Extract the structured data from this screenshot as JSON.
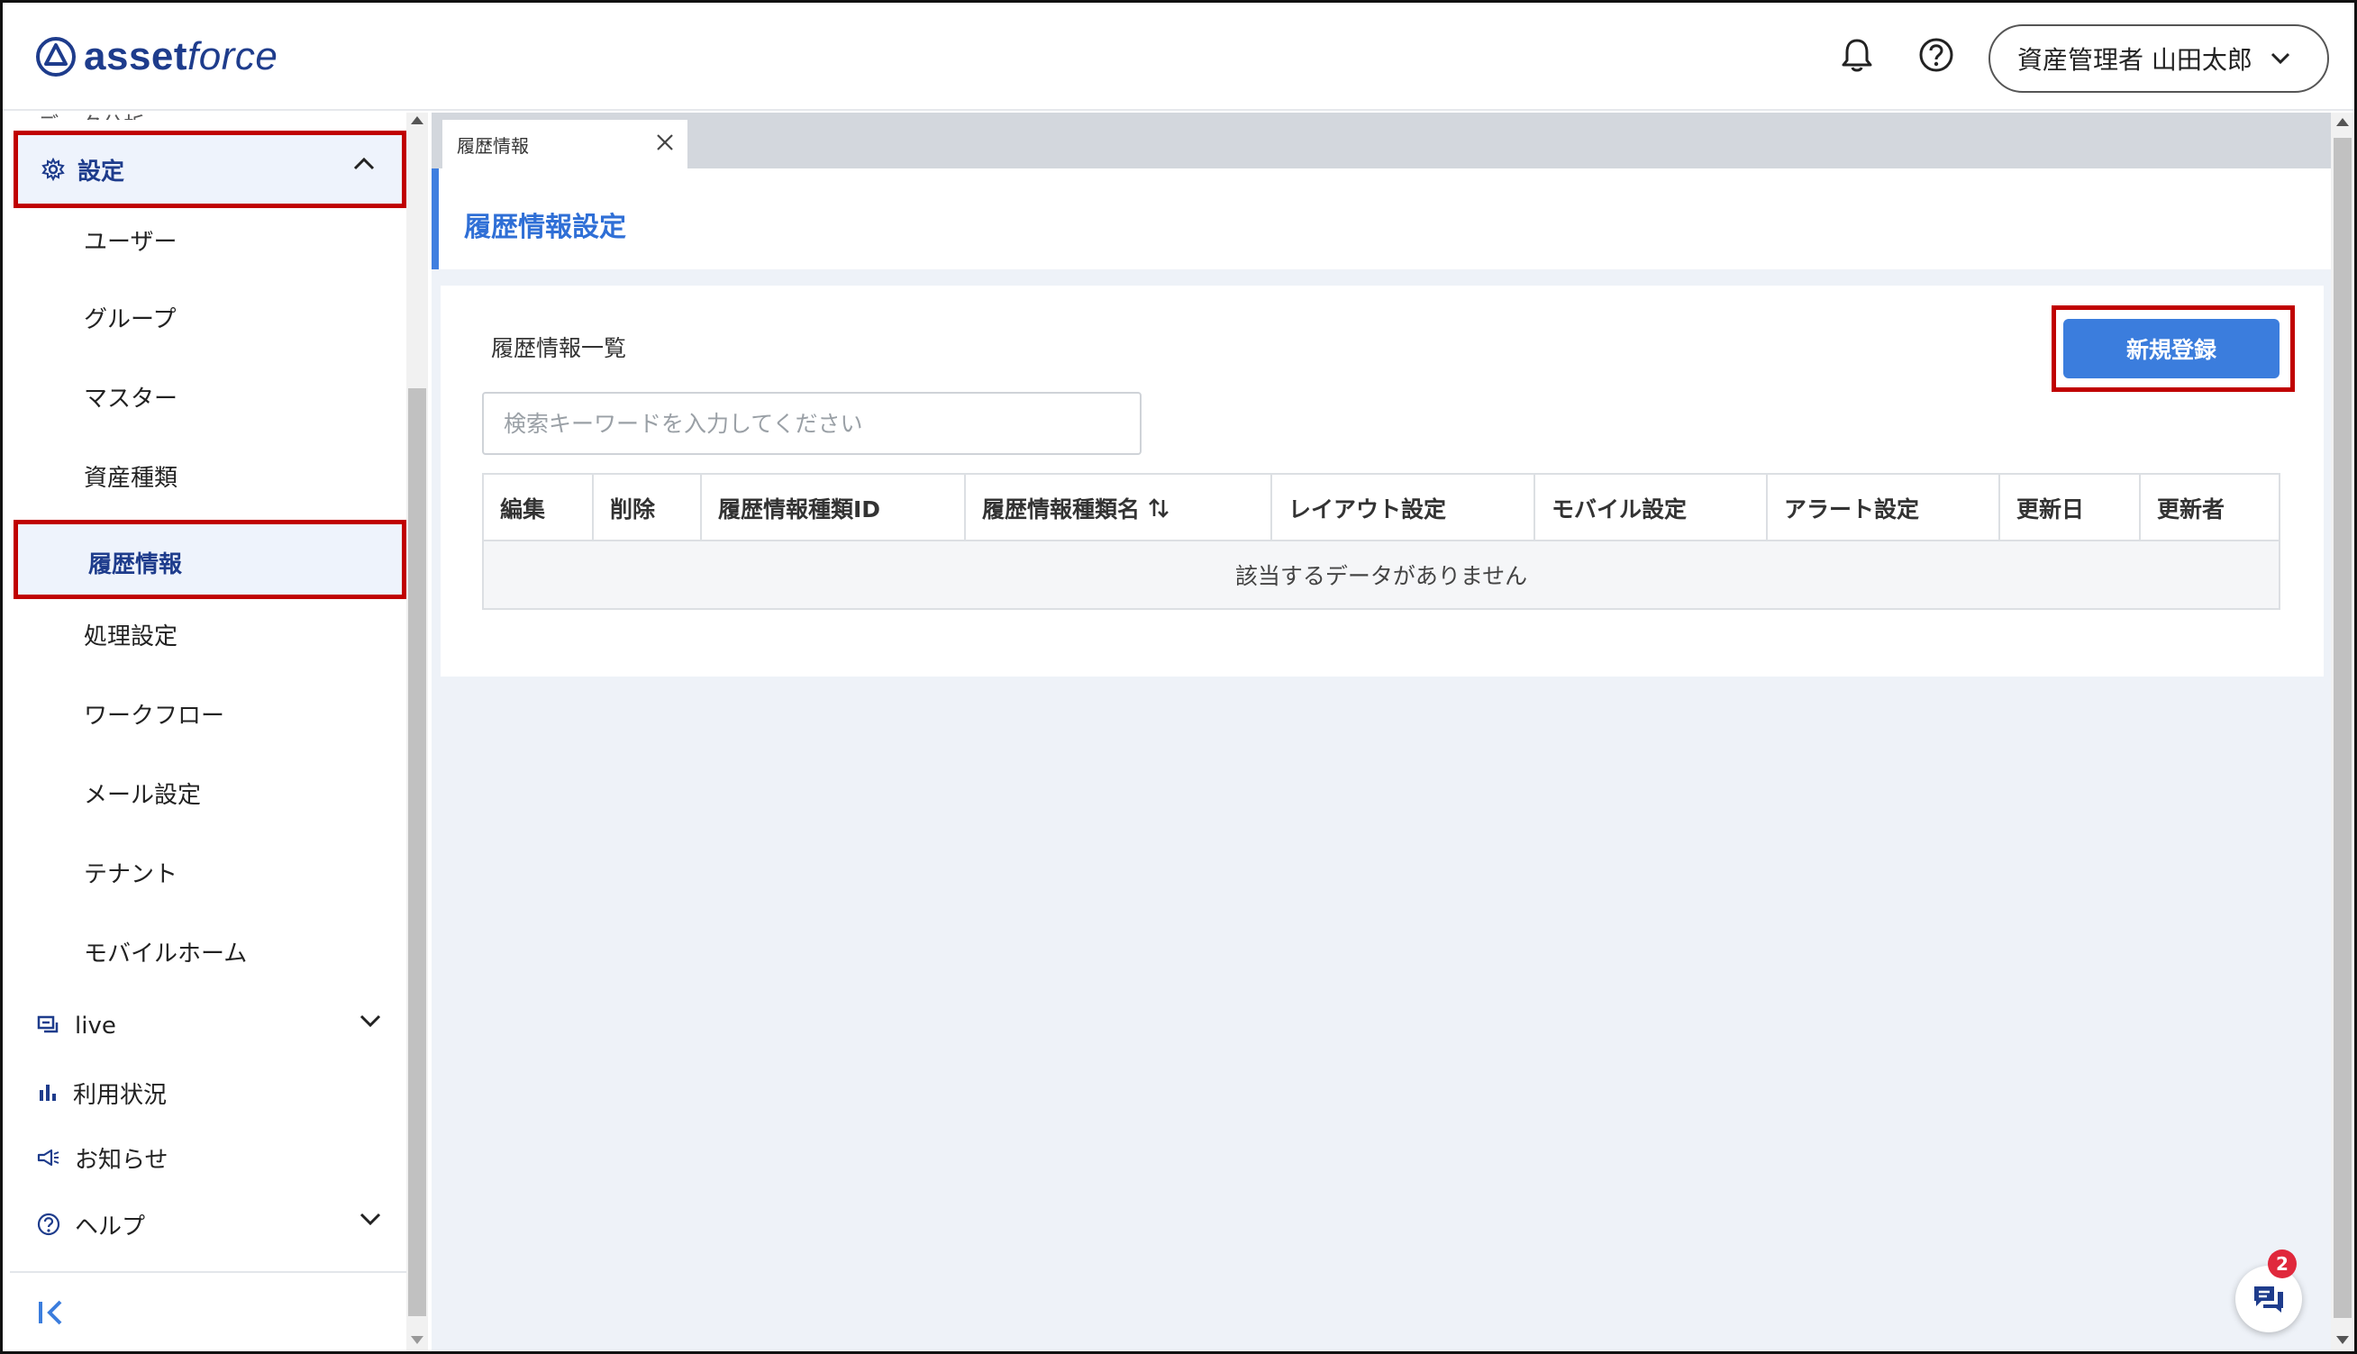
{
  "header": {
    "logo_bold": "asset",
    "logo_italic": "force",
    "user_label": "資産管理者 山田太郎"
  },
  "sidebar": {
    "cut_item": "データ分析",
    "settings_label": "設定",
    "sub_items": [
      {
        "label": "ユーザー"
      },
      {
        "label": "グループ"
      },
      {
        "label": "マスター"
      },
      {
        "label": "資産種類"
      },
      {
        "label": "履歴情報"
      },
      {
        "label": "処理設定"
      },
      {
        "label": "ワークフロー"
      },
      {
        "label": "メール設定"
      },
      {
        "label": "テナント"
      },
      {
        "label": "モバイルホーム"
      }
    ],
    "main_items": [
      {
        "label": "live"
      },
      {
        "label": "利用状況"
      },
      {
        "label": "お知らせ"
      },
      {
        "label": "ヘルプ"
      }
    ]
  },
  "tabs": [
    {
      "label": "履歴情報"
    }
  ],
  "page": {
    "title": "履歴情報設定",
    "list_title": "履歴情報一覧",
    "new_button": "新規登録",
    "search_placeholder": "検索キーワードを入力してください"
  },
  "table": {
    "columns": [
      "編集",
      "削除",
      "履歴情報種類ID",
      "履歴情報種類名",
      "レイアウト設定",
      "モバイル設定",
      "アラート設定",
      "更新日",
      "更新者"
    ],
    "empty_message": "該当するデータがありません"
  },
  "chat": {
    "badge_count": "2"
  },
  "colors": {
    "brand": "#1e3c8c",
    "accent": "#3b7ddd",
    "highlight_border": "#c00000"
  }
}
